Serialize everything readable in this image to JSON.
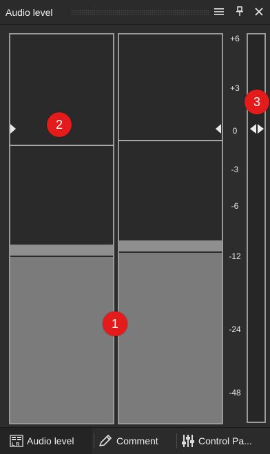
{
  "panel": {
    "title": "Audio level",
    "buttons": {
      "menu_icon": "menu-icon",
      "pin_icon": "pin-icon",
      "close_icon": "close-icon"
    }
  },
  "meter": {
    "scale_labels": [
      "+6",
      "+3",
      "0",
      "-3",
      "-6",
      "-12",
      "-24",
      "-48"
    ],
    "channels": [
      {
        "name": "left-channel"
      },
      {
        "name": "right-channel"
      }
    ],
    "gain_marker": "double-arrow-icon"
  },
  "badges": [
    "1",
    "2",
    "3"
  ],
  "tabs": [
    {
      "label": "Audio level",
      "icon": "audio-level-icon",
      "active": true
    },
    {
      "label": "Comment",
      "icon": "pen-icon",
      "active": false
    },
    {
      "label": "Control Pa...",
      "icon": "control-panel-icon",
      "active": false
    }
  ],
  "colors": {
    "background": "#2d2d2d",
    "meter_fill": "#7b7b7b",
    "meter_border": "#9a9a9a",
    "badge": "#e31b1b"
  }
}
